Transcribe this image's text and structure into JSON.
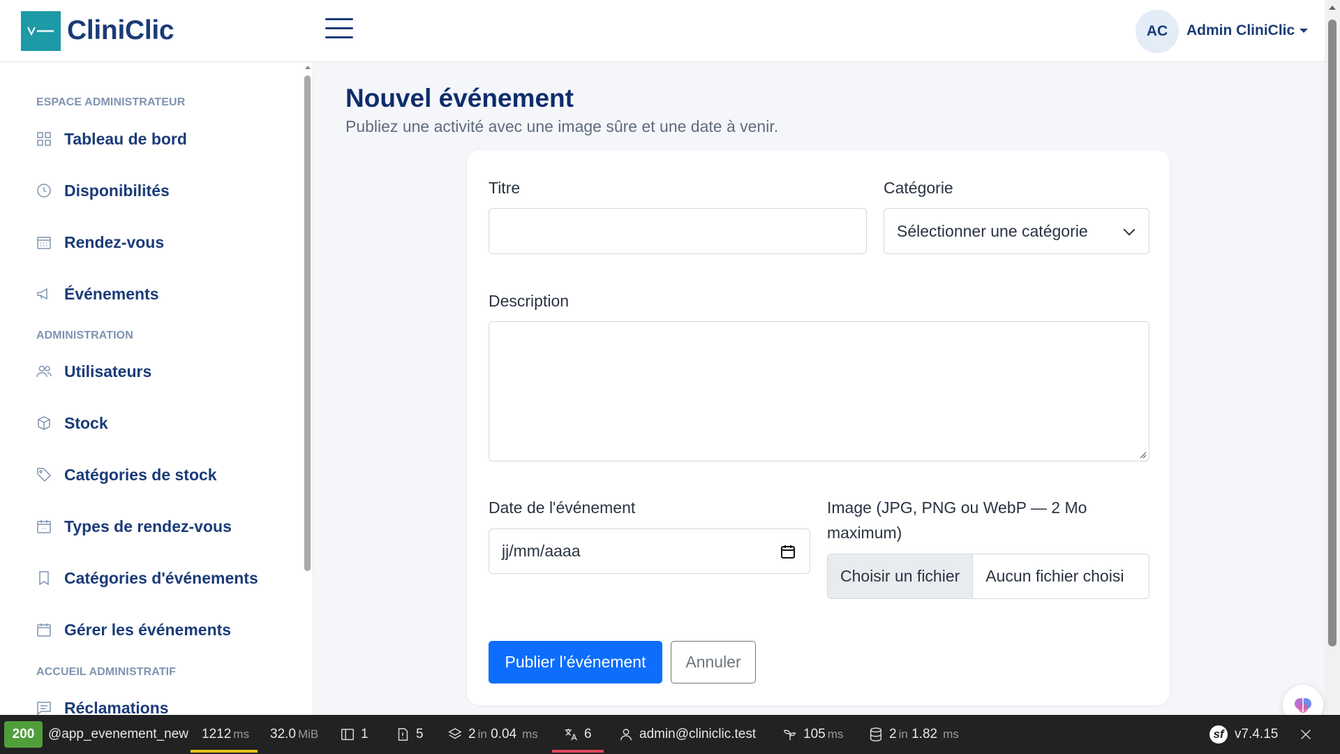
{
  "header": {
    "brand": "CliniClic",
    "avatar_initials": "AC",
    "user_name": "Admin CliniClic"
  },
  "sidebar": {
    "sections": [
      {
        "title": "ESPACE ADMINISTRATEUR"
      },
      {
        "title": "ADMINISTRATION"
      },
      {
        "title": "ACCUEIL ADMINISTRATIF"
      }
    ],
    "items": [
      {
        "label": "Tableau de bord",
        "icon": "grid-icon"
      },
      {
        "label": "Disponibilités",
        "icon": "clock-icon"
      },
      {
        "label": "Rendez-vous",
        "icon": "calendar-icon"
      },
      {
        "label": "Événements",
        "icon": "megaphone-icon"
      },
      {
        "label": "Utilisateurs",
        "icon": "users-icon"
      },
      {
        "label": "Stock",
        "icon": "box-icon"
      },
      {
        "label": "Catégories de stock",
        "icon": "tag-icon"
      },
      {
        "label": "Types de rendez-vous",
        "icon": "calendar-plus-icon"
      },
      {
        "label": "Catégories d'événements",
        "icon": "bookmark-icon"
      },
      {
        "label": "Gérer les événements",
        "icon": "calendar-check-icon"
      },
      {
        "label": "Réclamations",
        "icon": "chat-icon"
      }
    ]
  },
  "main": {
    "title": "Nouvel événement",
    "subtitle": "Publiez une activité avec une image sûre et une date à venir."
  },
  "form": {
    "title_label": "Titre",
    "title_value": "",
    "category_label": "Catégorie",
    "category_selected": "Sélectionner une catégorie",
    "description_label": "Description",
    "description_value": "",
    "date_label": "Date de l'événement",
    "date_value": "jj/mm/aaaa",
    "image_label_line1": "Image (JPG, PNG ou WebP — 2 Mo",
    "image_label_line2": "maximum)",
    "file_button": "Choisir un fichier",
    "file_status": "Aucun fichier choisi",
    "submit": "Publier l’événement",
    "cancel": "Annuler"
  },
  "debug_toolbar": {
    "status_code": "200",
    "route": "@app_evenement_new",
    "time_value": "1212",
    "time_unit": "ms",
    "memory_value": "32.0",
    "memory_unit": "MiB",
    "forms_count": "1",
    "logs_count": "5",
    "cache_value": "2",
    "cache_in": "in",
    "cache_time": "0.04",
    "cache_unit": "ms",
    "translation_count": "6",
    "user": "admin@cliniclic.test",
    "twig_value": "105",
    "twig_unit": "ms",
    "db_value": "2",
    "db_in": "in",
    "db_time": "1.82",
    "db_unit": "ms",
    "symfony_version": "v7.4.15"
  },
  "colors": {
    "brand": "#1b3b78",
    "primary": "#0d6efd",
    "status_ok": "#4f9e3a",
    "logo_bg": "#1c9aa5"
  }
}
